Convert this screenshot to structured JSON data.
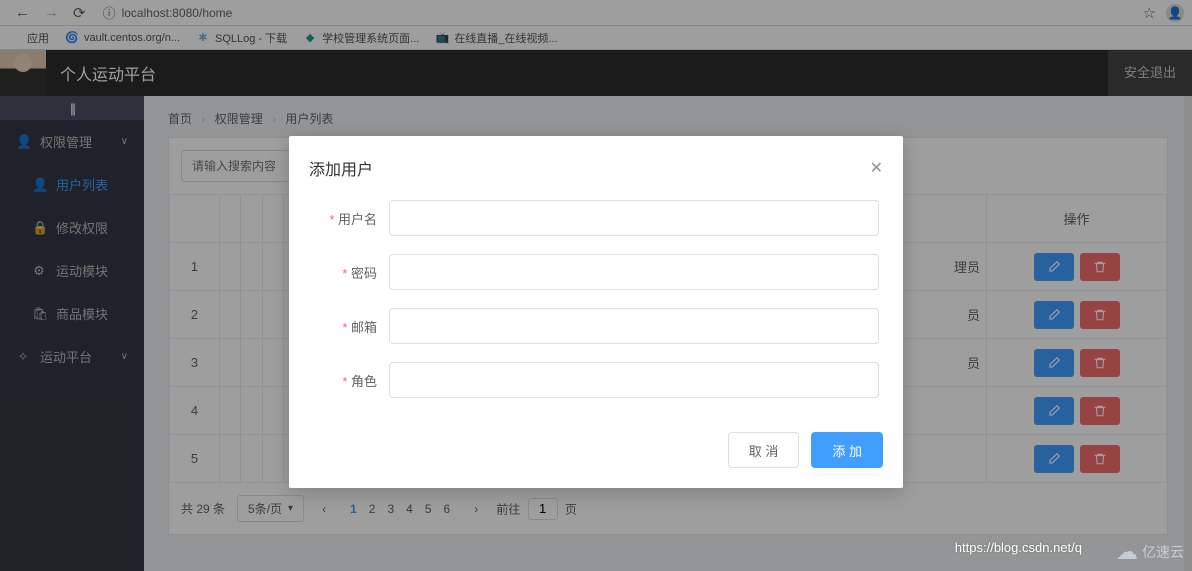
{
  "browser": {
    "address_prefix": "ⓘ",
    "address": "localhost:8080/home"
  },
  "bookmarks": {
    "apps": "应用",
    "items": [
      "vault.centos.org/n...",
      "SQLLog - 下载",
      "学校管理系统页面...",
      "在线直播_在线视频..."
    ]
  },
  "header": {
    "app_title": "个人运动平台",
    "logout": "安全退出"
  },
  "sidebar": {
    "items": [
      {
        "icon": "👤",
        "label": "权限管理",
        "arrow": "∨"
      },
      {
        "icon": "👤",
        "label": "用户列表",
        "sub": true,
        "active": true
      },
      {
        "icon": "🔒",
        "label": "修改权限",
        "sub": true
      },
      {
        "icon": "⚙",
        "label": "运动模块",
        "sub": true
      },
      {
        "icon": "🛍",
        "label": "商品模块",
        "sub": true
      },
      {
        "icon": "✧",
        "label": "运动平台",
        "arrow": "∨"
      }
    ]
  },
  "breadcrumb": {
    "b1": "首页",
    "b2": "权限管理",
    "b3": "用户列表",
    "sep": "›"
  },
  "search": {
    "placeholder": "请输入搜索内容"
  },
  "table": {
    "col_action": "操作",
    "col_role_frag": "员",
    "rows": [
      {
        "idx": "1",
        "frag": "理员"
      },
      {
        "idx": "2",
        "frag": "员"
      },
      {
        "idx": "3",
        "frag": "员"
      },
      {
        "idx": "4",
        "frag": ""
      },
      {
        "idx": "5",
        "frag": ""
      }
    ]
  },
  "pagination": {
    "total": "共 29 条",
    "per_page": "5条/页",
    "pages": [
      "1",
      "2",
      "3",
      "4",
      "5",
      "6"
    ],
    "goto_prefix": "前往",
    "goto_value": "1",
    "goto_suffix": "页"
  },
  "dialog": {
    "title": "添加用户",
    "fields": {
      "username": "用户名",
      "password": "密码",
      "email": "邮箱",
      "role": "角色"
    },
    "cancel": "取 消",
    "submit": "添 加"
  },
  "watermark": {
    "url": "https://blog.csdn.net/q",
    "logo_text": "亿速云"
  }
}
